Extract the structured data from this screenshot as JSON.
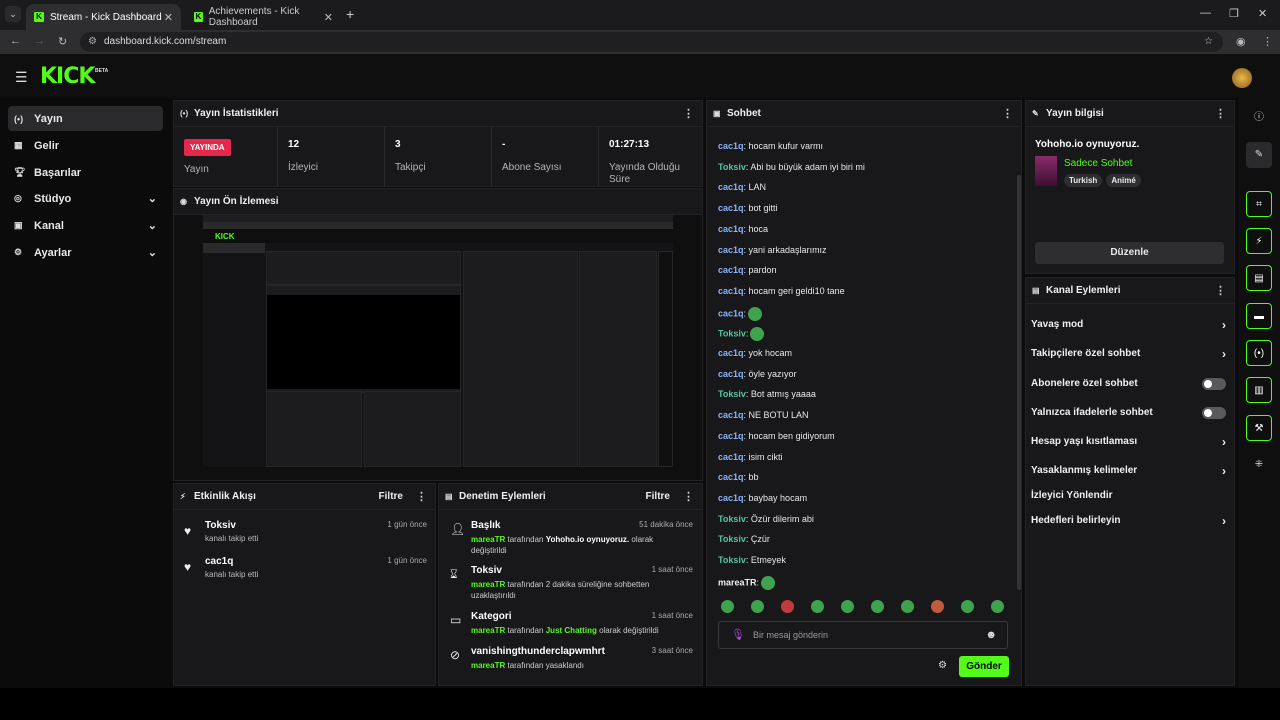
{
  "browser": {
    "tabs": [
      {
        "label": "Stream - Kick Dashboard",
        "active": true
      },
      {
        "label": "Achievements - Kick Dashboard",
        "active": false
      }
    ],
    "url": "dashboard.kick.com/stream"
  },
  "app": {
    "logo": "KICK",
    "badge": "BETA"
  },
  "sidebar": {
    "items": [
      {
        "label": "Yayın",
        "icon": "broadcast-icon"
      },
      {
        "label": "Gelir",
        "icon": "revenue-icon"
      },
      {
        "label": "Başarılar",
        "icon": "trophy-icon"
      },
      {
        "label": "Stüdyo",
        "icon": "studio-icon"
      },
      {
        "label": "Kanal",
        "icon": "channel-icon"
      },
      {
        "label": "Ayarlar",
        "icon": "gear-icon"
      }
    ]
  },
  "stats": {
    "title": "Yayın İstatistikleri",
    "live_badge": "YAYINDA",
    "cells": [
      {
        "value": "",
        "label": "Yayın"
      },
      {
        "value": "12",
        "label": "İzleyici"
      },
      {
        "value": "3",
        "label": "Takipçi"
      },
      {
        "value": "-",
        "label": "Abone Sayısı"
      },
      {
        "value": "01:27:13",
        "label": "Yayında Olduğu Süre"
      }
    ]
  },
  "preview": {
    "title": "Yayın Ön İzlemesi"
  },
  "activity": {
    "title": "Etkinlik Akışı",
    "filter": "Filtre",
    "items": [
      {
        "name": "Toksiv",
        "desc": "kanalı takip etti",
        "time": "1 gün önce"
      },
      {
        "name": "cac1q",
        "desc": "kanalı takip etti",
        "time": "1 gün önce"
      }
    ]
  },
  "moderation": {
    "title": "Denetim Eylemleri",
    "filter": "Filtre",
    "items": [
      {
        "name": "Başlık",
        "time": "51 dakika önce",
        "user": "mareaTR",
        "pre": " tarafından ",
        "bold": "Yohoho.io oynuyoruz.",
        "post": " olarak değiştirildi"
      },
      {
        "name": "Toksiv",
        "time": "1 saat önce",
        "user": "mareaTR",
        "pre": " tarafından 2 dakika süreliğine sohbetten uzaklaştırıldı",
        "bold": "",
        "post": ""
      },
      {
        "name": "Kategori",
        "time": "1 saat önce",
        "user": "mareaTR",
        "pre": " tarafından ",
        "bold": "Just Chatting",
        "post": " olarak değiştirildi"
      },
      {
        "name": "vanishingthunderclapwmhrt",
        "time": "3 saat önce",
        "user": "mareaTR",
        "pre": " tarafından yasaklandı",
        "bold": "",
        "post": ""
      }
    ]
  },
  "chat": {
    "title": "Sohbet",
    "messages": [
      {
        "user": "cac1q",
        "text": ": hocam kufur varmı"
      },
      {
        "user": "Toksiv",
        "text": ": Abi bu büyük adam iyi biri mi"
      },
      {
        "user": "cac1q",
        "text": ": LAN"
      },
      {
        "user": "cac1q",
        "text": ": bot gitti"
      },
      {
        "user": "cac1q",
        "text": ": hoca"
      },
      {
        "user": "cac1q",
        "text": ": yani arkadaşlarımız"
      },
      {
        "user": "cac1q",
        "text": ": pardon"
      },
      {
        "user": "cac1q",
        "text": ": hocam geri geldi10 tane"
      },
      {
        "user": "cac1q",
        "text": ":",
        "emote": true
      },
      {
        "user": "Toksiv",
        "text": ":",
        "emote": true
      },
      {
        "user": "cac1q",
        "text": ": yok hocam"
      },
      {
        "user": "cac1q",
        "text": ": öyle yazıyor"
      },
      {
        "user": "Toksiv",
        "text": ": Bot atmış yaaaa"
      },
      {
        "user": "cac1q",
        "text": ": NE BOTU LAN"
      },
      {
        "user": "cac1q",
        "text": ": hocam ben gidiyorum"
      },
      {
        "user": "cac1q",
        "text": ": isim cikti"
      },
      {
        "user": "cac1q",
        "text": ": bb"
      },
      {
        "user": "cac1q",
        "text": ": baybay hocam"
      },
      {
        "user": "Toksiv",
        "text": ": Özür dilerim abi"
      },
      {
        "user": "Toksiv",
        "text": ": Çzür"
      },
      {
        "user": "Toksiv",
        "text": ": Etmeyek"
      },
      {
        "user": "mareaTR",
        "text": ":",
        "emote": true
      }
    ],
    "input_placeholder": "Bir mesaj gönderin",
    "send_label": "Gönder"
  },
  "stream_info": {
    "title": "Yayın bilgisi",
    "stream_title": "Yohoho.io oynuyoruz.",
    "mode": "Sadece Sohbet",
    "tags": [
      "Turkish",
      "Animé"
    ],
    "edit_label": "Düzenle"
  },
  "channel_actions": {
    "title": "Kanal Eylemleri",
    "items": [
      {
        "label": "Yavaş mod",
        "control": "chevron"
      },
      {
        "label": "Takipçilere özel sohbet",
        "control": "chevron"
      },
      {
        "label": "Abonelere özel sohbet",
        "control": "toggle"
      },
      {
        "label": "Yalnızca ifadelerle sohbet",
        "control": "toggle"
      },
      {
        "label": "Hesap yaşı kısıtlaması",
        "control": "chevron"
      },
      {
        "label": "Yasaklanmış kelimeler",
        "control": "chevron"
      },
      {
        "label": "İzleyici Yönlendir",
        "control": "none"
      },
      {
        "label": "Hedefleri belirleyin",
        "control": "chevron"
      }
    ]
  },
  "colors": {
    "accent": "#53fc18",
    "live": "#e3284b",
    "panel": "#18181b"
  }
}
